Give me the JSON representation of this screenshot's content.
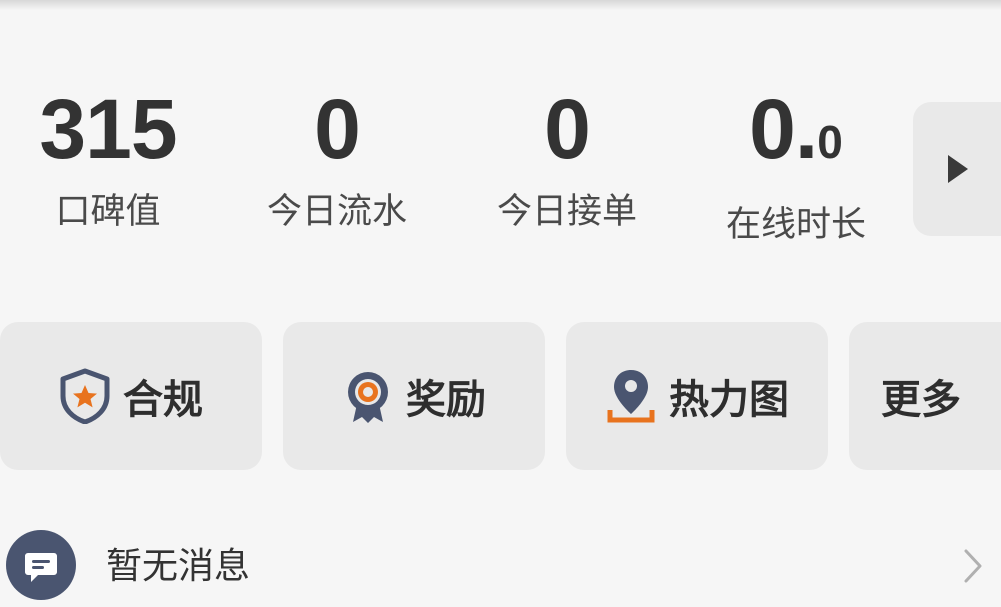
{
  "stats": [
    {
      "value": "315",
      "label": "口碑值"
    },
    {
      "value": "0",
      "label": "今日流水"
    },
    {
      "value": "0",
      "label": "今日接单"
    },
    {
      "value_int": "0.",
      "value_dec": "0",
      "label": "在线时长"
    }
  ],
  "next_icon": "play-arrow-icon",
  "shortcuts": [
    {
      "label": "合规",
      "icon": "shield-star-icon"
    },
    {
      "label": "奖励",
      "icon": "award-badge-icon"
    },
    {
      "label": "热力图",
      "icon": "map-pin-icon"
    },
    {
      "label": "更多"
    }
  ],
  "message": {
    "text": "暂无消息",
    "icon": "chat-bubble-icon",
    "chevron_icon": "chevron-right-icon"
  },
  "colors": {
    "background": "#f6f6f6",
    "tile": "#e9e9e9",
    "text": "#333333",
    "icon_navy": "#4a5570",
    "accent_orange": "#e8731e"
  }
}
